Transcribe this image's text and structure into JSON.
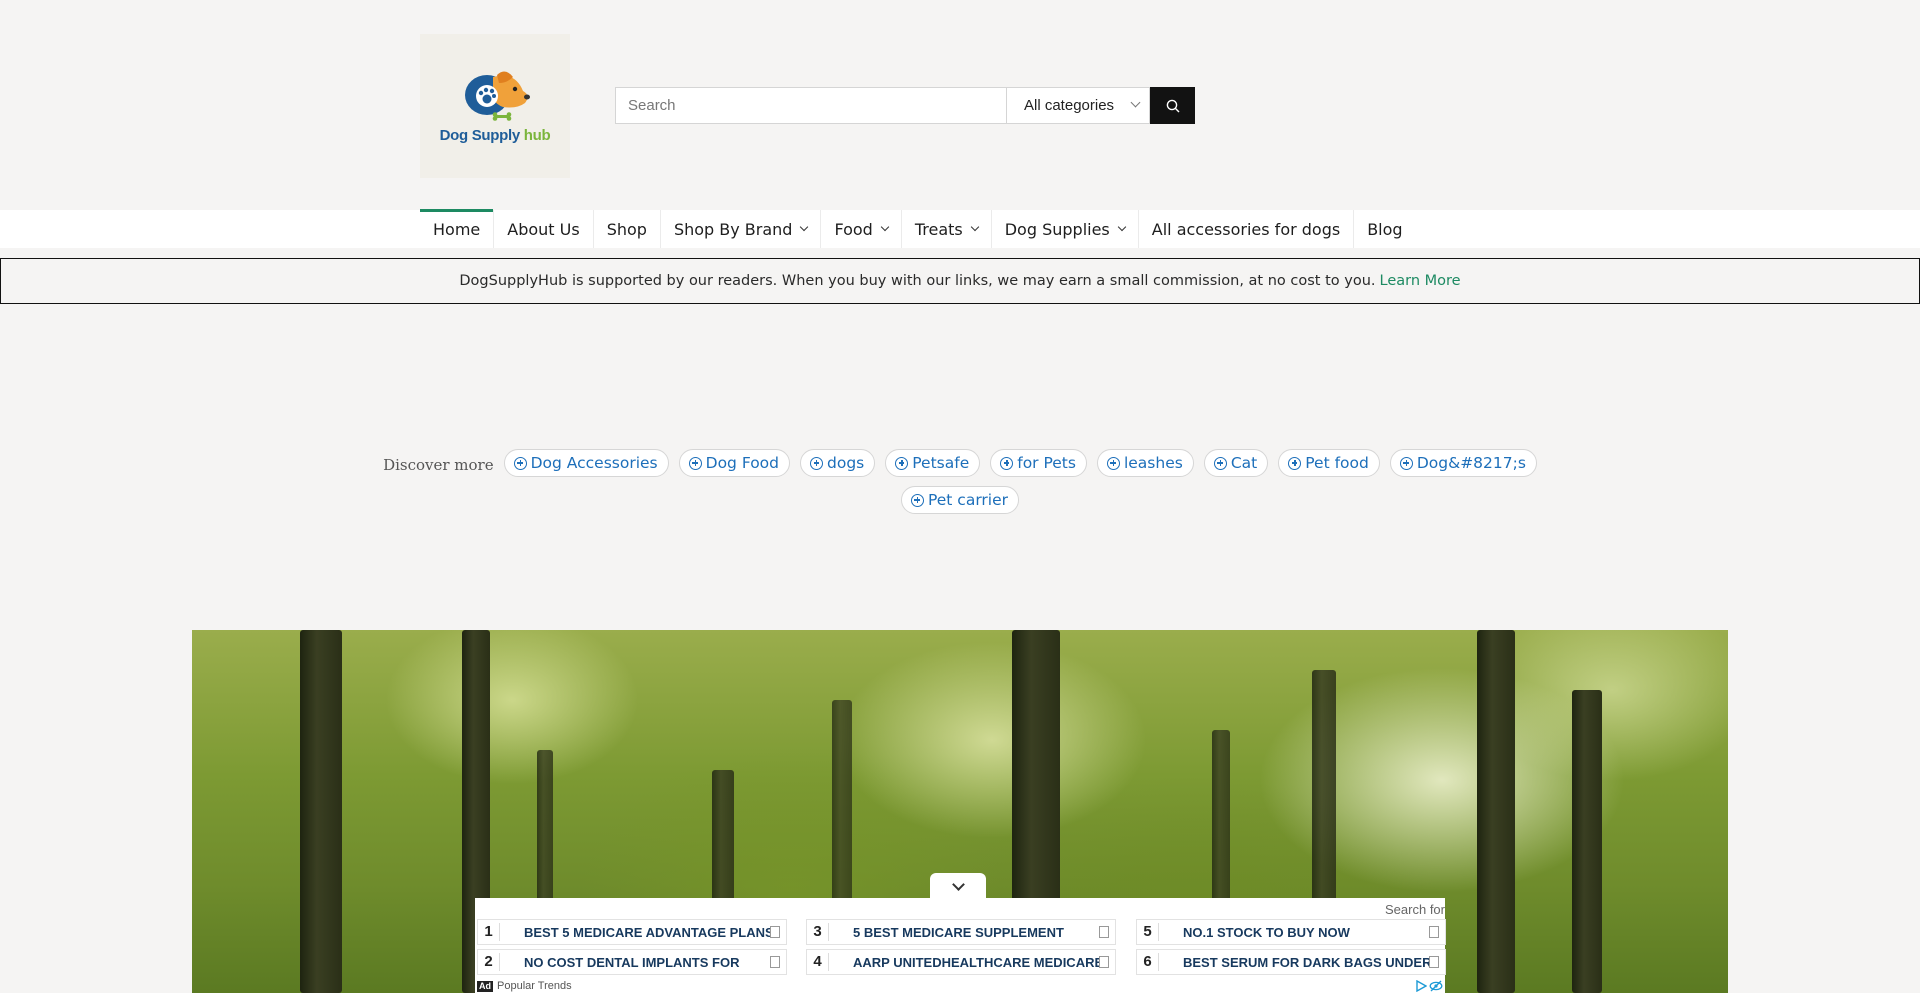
{
  "logo": {
    "text_part1": "Dog Supply",
    "text_part2": "hub"
  },
  "search": {
    "placeholder": "Search",
    "category": "All categories"
  },
  "nav": {
    "items": [
      {
        "label": "Home",
        "active": true,
        "has_dropdown": false
      },
      {
        "label": "About Us",
        "has_dropdown": false
      },
      {
        "label": "Shop",
        "has_dropdown": false
      },
      {
        "label": "Shop By Brand",
        "has_dropdown": true
      },
      {
        "label": "Food",
        "has_dropdown": true
      },
      {
        "label": "Treats",
        "has_dropdown": true
      },
      {
        "label": "Dog Supplies",
        "has_dropdown": true
      },
      {
        "label": "All accessories for dogs",
        "has_dropdown": false
      },
      {
        "label": "Blog",
        "has_dropdown": false
      }
    ]
  },
  "notice": {
    "text": "DogSupplyHub is supported by our readers. When you buy with our links, we may earn a small commission, at no cost to you.",
    "link": "Learn More"
  },
  "discover": {
    "label": "Discover more",
    "chips": [
      "Dog Accessories",
      "Dog Food",
      "dogs",
      "Petsafe",
      "for Pets",
      "leashes",
      "Cat",
      "Pet food",
      "Dog&#8217;s",
      "Pet carrier"
    ]
  },
  "ad": {
    "search_label": "Search for",
    "items": [
      {
        "num": "1",
        "text": "BEST 5 MEDICARE ADVANTAGE PLANS"
      },
      {
        "num": "2",
        "text": "NO COST DENTAL IMPLANTS FOR"
      },
      {
        "num": "3",
        "text": "5 BEST MEDICARE SUPPLEMENT"
      },
      {
        "num": "4",
        "text": "AARP UNITEDHEALTHCARE MEDICARE"
      },
      {
        "num": "5",
        "text": "NO.1 STOCK TO BUY NOW"
      },
      {
        "num": "6",
        "text": "BEST SERUM FOR DARK BAGS UNDER"
      }
    ],
    "badge": "Ad",
    "footer": "Popular Trends"
  },
  "colors": {
    "accent": "#1d8a62",
    "chip_text": "#1d6fba",
    "ad_text": "#17395e"
  }
}
